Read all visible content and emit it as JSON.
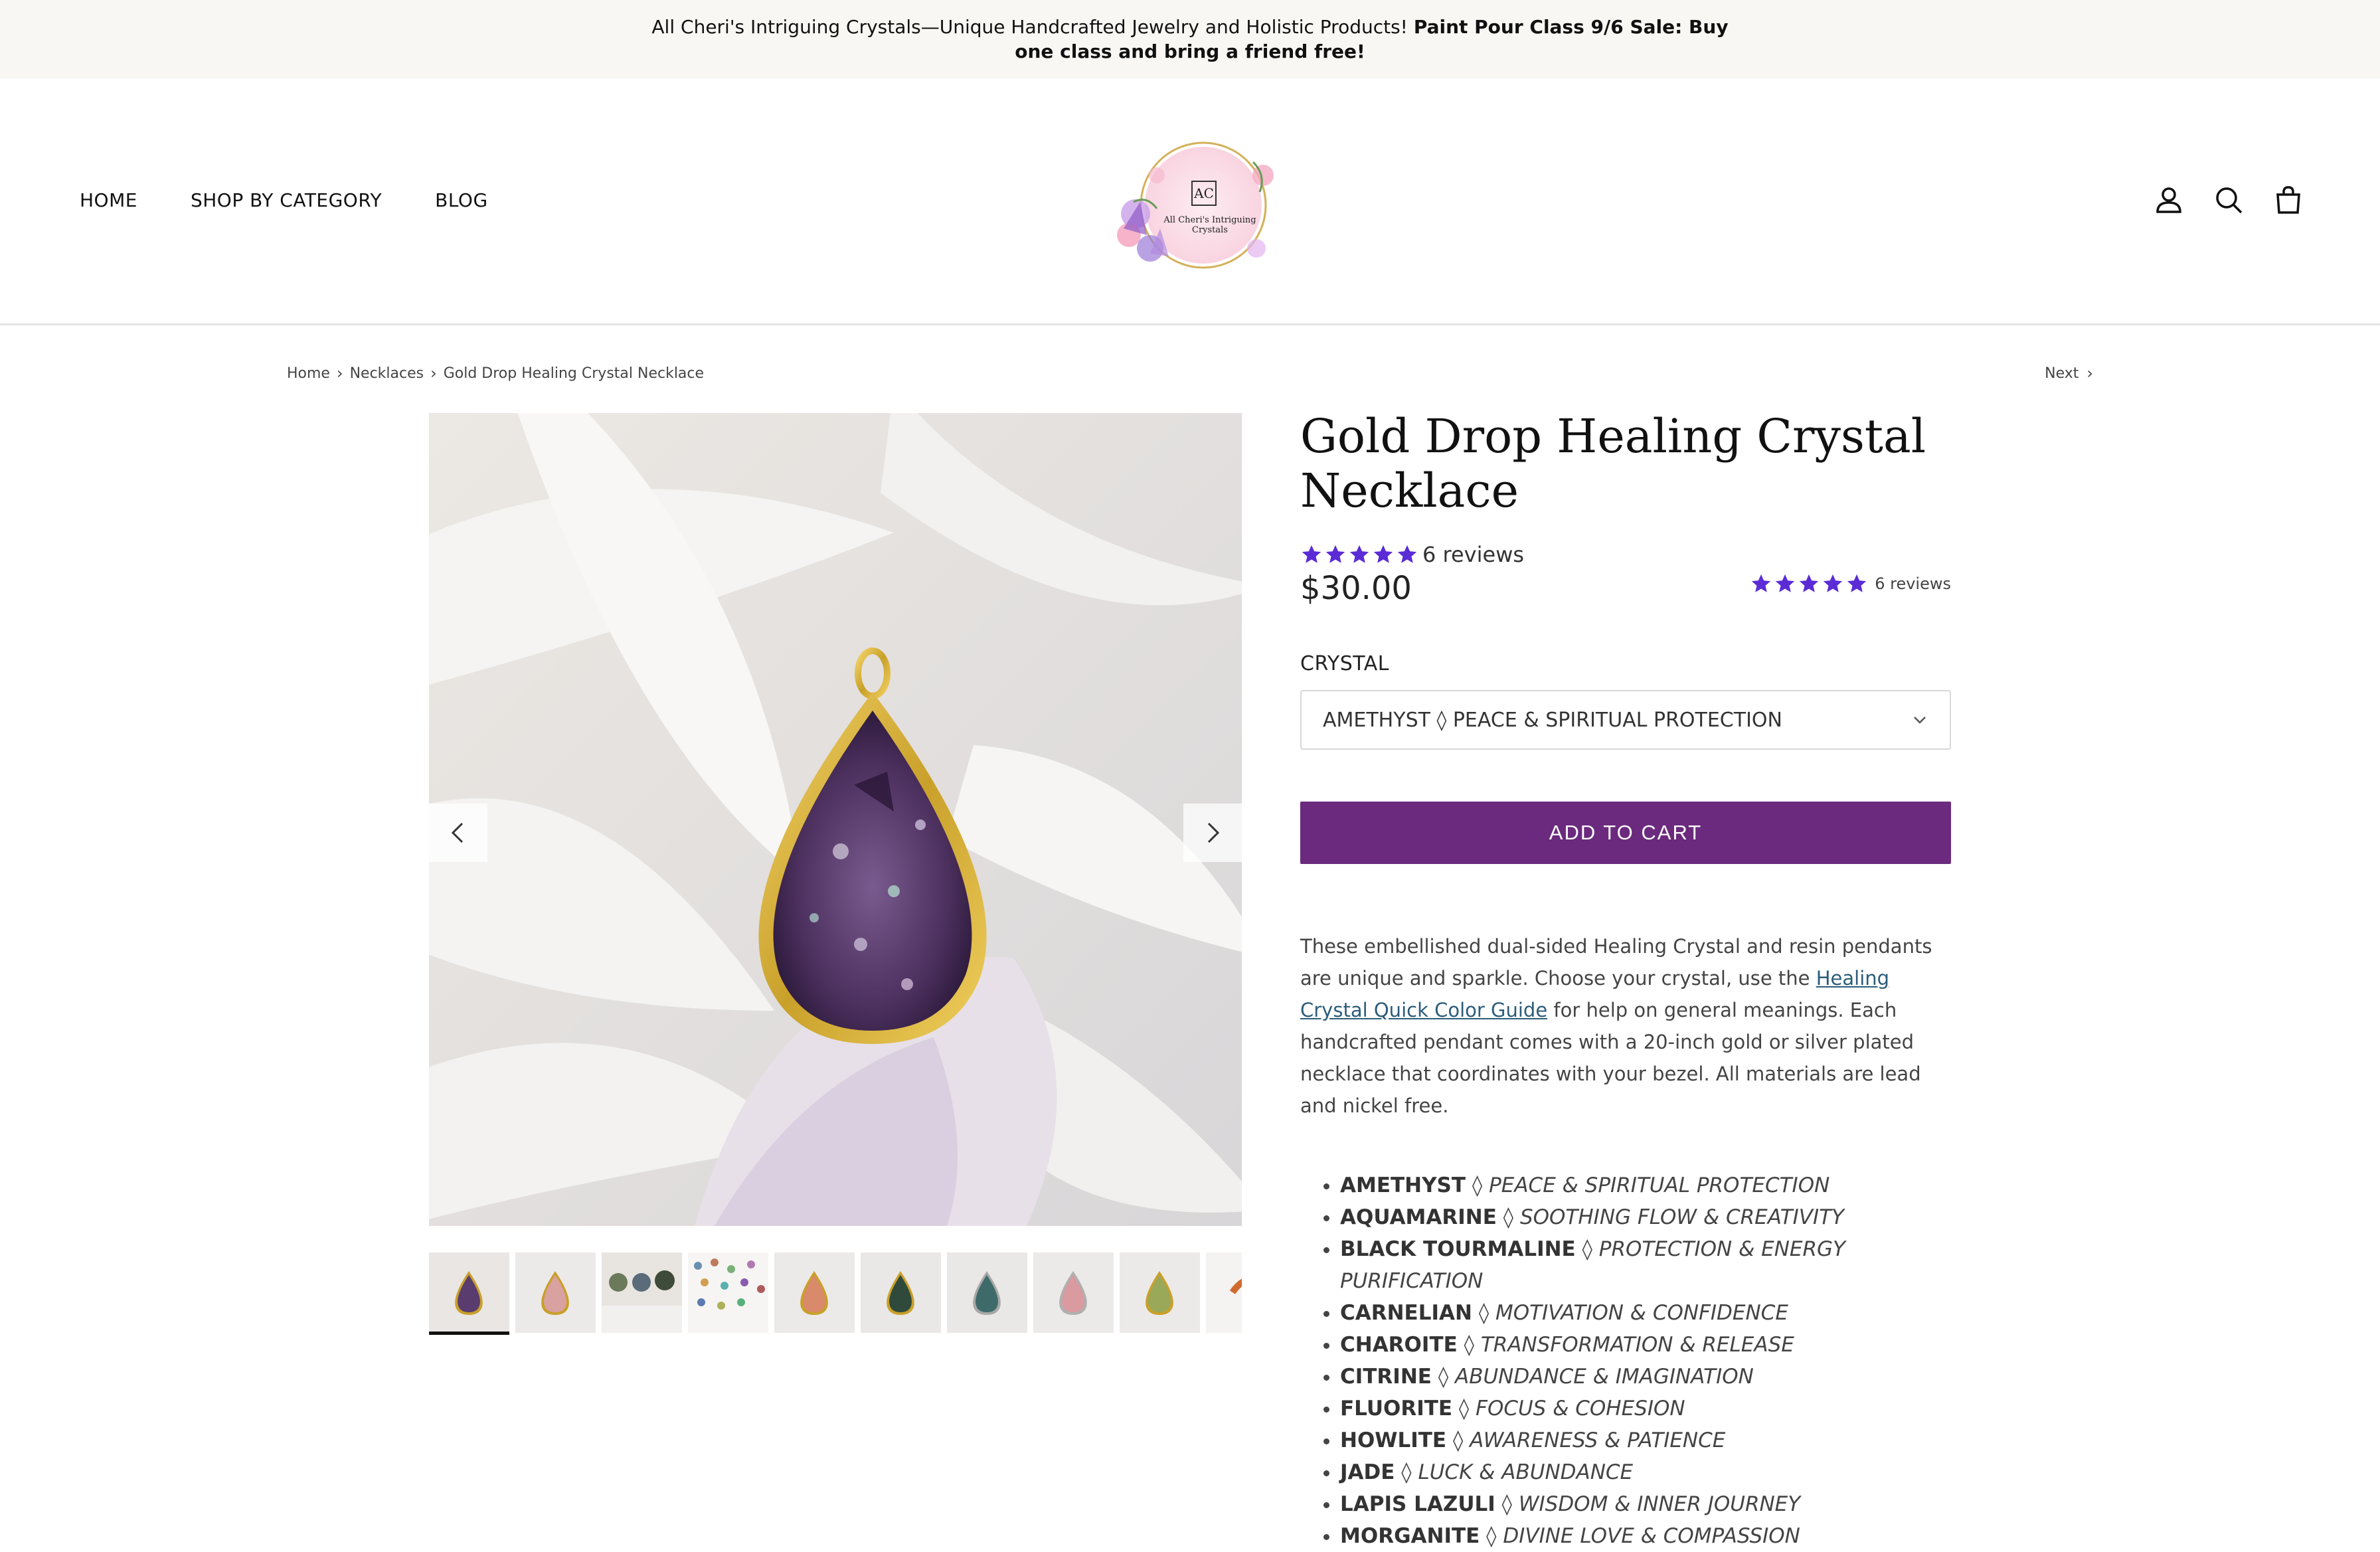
{
  "announcement": {
    "text": "All Cheri's Intriguing Crystals—Unique Handcrafted Jewelry and Holistic Products!",
    "promo": "Paint Pour Class 9/6 Sale: Buy one class and bring a friend free!"
  },
  "nav": {
    "items": [
      {
        "label": "HOME"
      },
      {
        "label": "SHOP BY CATEGORY"
      },
      {
        "label": "BLOG"
      }
    ]
  },
  "logo": {
    "monogram": "AC",
    "text": "All Cheri's Intriguing Crystals"
  },
  "header_icons": [
    "account-icon",
    "search-icon",
    "cart-icon"
  ],
  "breadcrumb": {
    "items": [
      "Home",
      "Necklaces",
      "Gold Drop Healing Crystal Necklace"
    ],
    "next_label": "Next"
  },
  "product": {
    "title": "Gold Drop Healing Crystal Necklace",
    "rating_stars": 5,
    "reviews_label": "6 reviews",
    "price": "$30.00",
    "rating2_label": "6 reviews",
    "option_label": "CRYSTAL",
    "option_selected": "AMETHYST ◊ PEACE & SPIRITUAL PROTECTION",
    "add_to_cart": "ADD TO CART",
    "desc": {
      "part1": "These embellished dual-sided Healing Crystal and resin pendants are unique and sparkle. Choose your crystal, use the ",
      "link": "Healing Crystal Quick Color Guide",
      "part2": " for help on general meanings. Each handcrafted pendant comes with a 20-inch gold or silver plated necklace that coordinates with your bezel. All materials are lead and nickel free."
    },
    "crystals": [
      {
        "name": "AMETHYST",
        "meaning": "PEACE & SPIRITUAL PROTECTION"
      },
      {
        "name": "AQUAMARINE",
        "meaning": "SOOTHING FLOW & CREATIVITY"
      },
      {
        "name": "BLACK TOURMALINE",
        "meaning": "PROTECTION & ENERGY PURIFICATION"
      },
      {
        "name": "CARNELIAN",
        "meaning": "MOTIVATION & CONFIDENCE"
      },
      {
        "name": "CHAROITE",
        "meaning": "TRANSFORMATION & RELEASE"
      },
      {
        "name": "CITRINE",
        "meaning": "ABUNDANCE & IMAGINATION"
      },
      {
        "name": "FLUORITE",
        "meaning": "FOCUS & COHESION"
      },
      {
        "name": "HOWLITE",
        "meaning": "AWARENESS & PATIENCE"
      },
      {
        "name": "JADE",
        "meaning": "LUCK & ABUNDANCE"
      },
      {
        "name": "LAPIS LAZULI",
        "meaning": "WISDOM & INNER JOURNEY"
      },
      {
        "name": "MORGANITE",
        "meaning": "DIVINE LOVE & COMPASSION"
      }
    ]
  },
  "colors": {
    "accent_purple": "#6b2a7e",
    "star_purple": "#5b2bd6",
    "link": "#2c5d7a",
    "announce_bg": "#f8f7f3"
  }
}
